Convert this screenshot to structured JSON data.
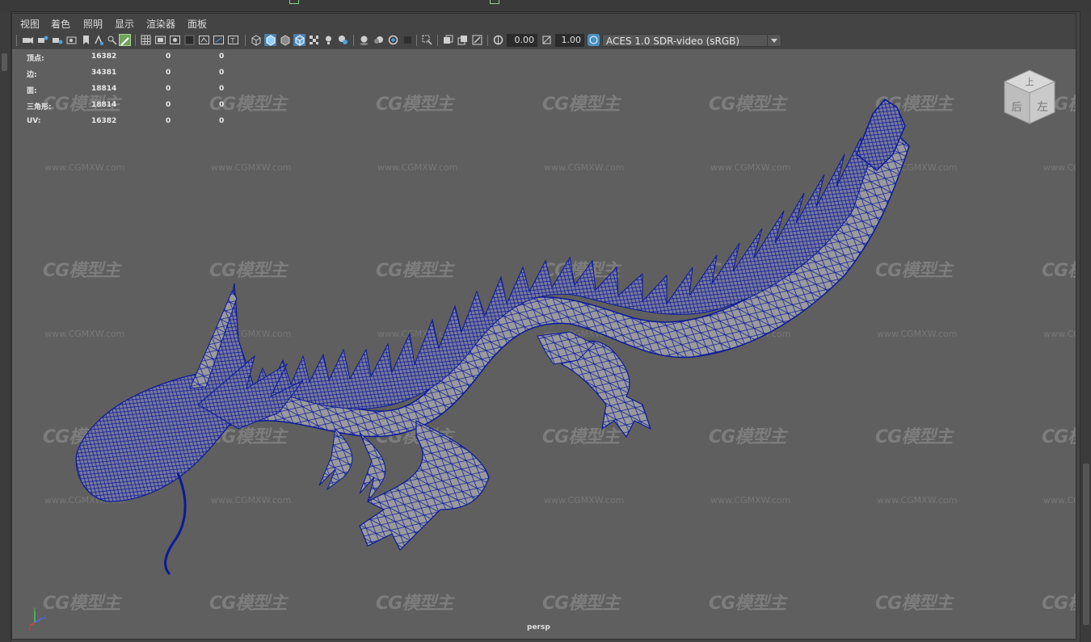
{
  "menu": {
    "items": [
      "视图",
      "着色",
      "照明",
      "显示",
      "渲染器",
      "面板"
    ]
  },
  "toolbar": {
    "exposure_value": "0.00",
    "gamma_value": "1.00",
    "color_management": "ACES 1.0 SDR-video (sRGB)"
  },
  "hud": {
    "rows": [
      {
        "label": "顶点:",
        "total": "16382",
        "selected": "0",
        "component": "0"
      },
      {
        "label": "边:",
        "total": "34381",
        "selected": "0",
        "component": "0"
      },
      {
        "label": "面:",
        "total": "18814",
        "selected": "0",
        "component": "0"
      },
      {
        "label": "三角形:",
        "total": "18814",
        "selected": "0",
        "component": "0"
      },
      {
        "label": "UV:",
        "total": "16382",
        "selected": "0",
        "component": "0"
      }
    ]
  },
  "viewcube": {
    "faces": [
      "上",
      "后",
      "左"
    ]
  },
  "viewport": {
    "camera": "persp",
    "axis": {
      "x": "x",
      "y": "y",
      "z": "z"
    }
  },
  "watermark": {
    "logo": "CG模型主",
    "url": "www.CGMXW.com"
  },
  "colors": {
    "wireframe": "#0a1a9a",
    "mesh_fill": "#9a9a9e",
    "viewport_bg": "#5f5f5f",
    "ui_bg": "#444444"
  }
}
